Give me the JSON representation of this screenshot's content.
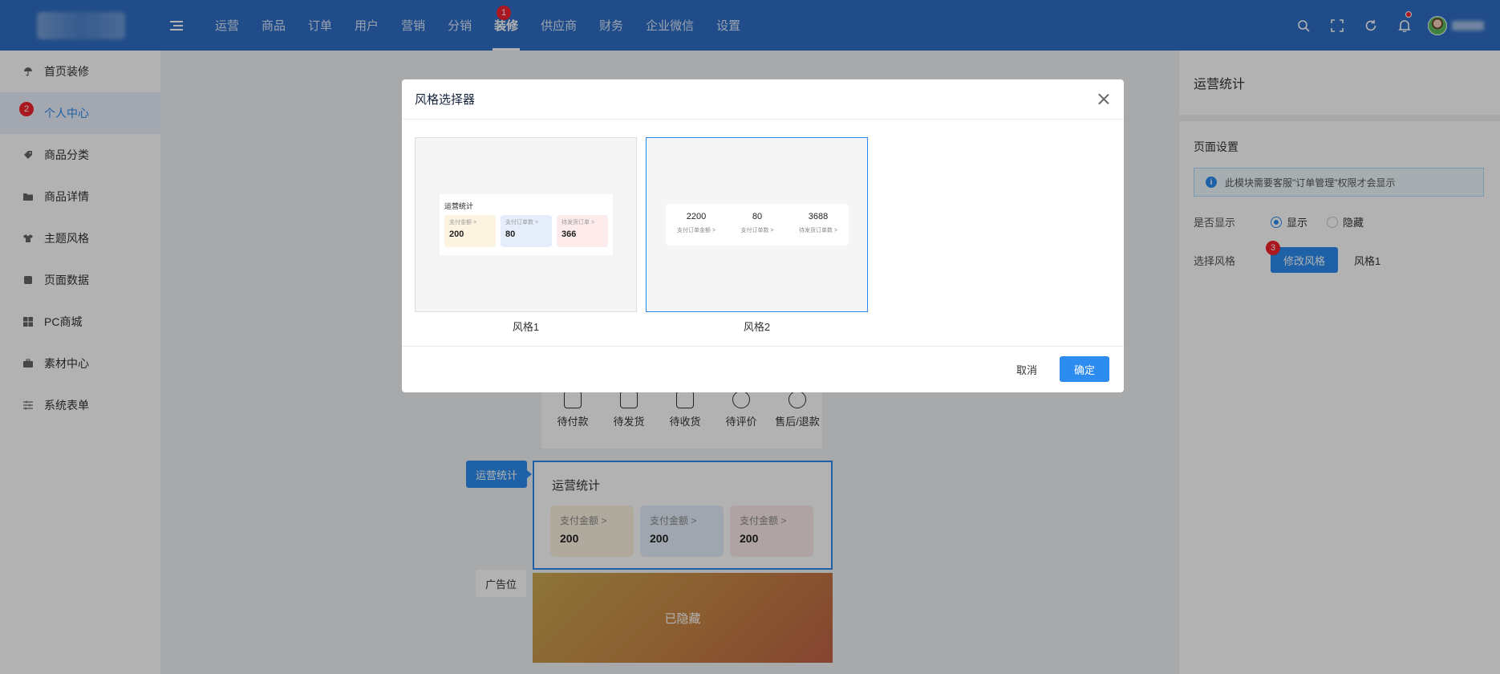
{
  "nav": {
    "items": [
      "运营",
      "商品",
      "订单",
      "用户",
      "营销",
      "分销",
      "装修",
      "供应商",
      "财务",
      "企业微信",
      "设置"
    ],
    "active_index": 6,
    "active_badge": "1"
  },
  "sidebar": {
    "items": [
      {
        "label": "首页装修",
        "icon": "umbrella-icon"
      },
      {
        "label": "个人中心",
        "icon": "user-icon"
      },
      {
        "label": "商品分类",
        "icon": "tag-icon"
      },
      {
        "label": "商品详情",
        "icon": "folder-icon"
      },
      {
        "label": "主题风格",
        "icon": "shirt-icon"
      },
      {
        "label": "页面数据",
        "icon": "database-icon"
      },
      {
        "label": "PC商城",
        "icon": "windows-icon"
      },
      {
        "label": "素材中心",
        "icon": "briefcase-icon"
      },
      {
        "label": "系统表单",
        "icon": "sliders-icon"
      }
    ],
    "active_index": 1,
    "active_badge": "2"
  },
  "canvas": {
    "order_items": [
      "待付款",
      "待发货",
      "待收货",
      "待评价",
      "售后/退款"
    ],
    "stats_tag": "运营统计",
    "stats_title": "运营统计",
    "stats_cards": [
      {
        "label": "支付金额 >",
        "value": "200",
        "color": "#fdf3e1"
      },
      {
        "label": "支付金额 >",
        "value": "200",
        "color": "#e6eefb"
      },
      {
        "label": "支付金额 >",
        "value": "200",
        "color": "#fdeaea"
      }
    ],
    "ad_tag": "广告位",
    "banner_text": "已隐藏"
  },
  "right_panel": {
    "title": "运营统计",
    "section_title": "页面设置",
    "notice": "此模块需要客服\"订单管理\"权限才会显示",
    "show_label": "是否显示",
    "show_option": "显示",
    "hide_option": "隐藏",
    "style_label": "选择风格",
    "style_button": "修改风格",
    "style_badge": "3",
    "style_value": "风格1"
  },
  "dialog": {
    "title": "风格选择器",
    "options": [
      {
        "name": "风格1",
        "preview_title": "运营统计",
        "cards": [
          {
            "label": "支付金额 >",
            "value": "200",
            "color": "#fdf3e1"
          },
          {
            "label": "支付订单数 >",
            "value": "80",
            "color": "#e6eefb"
          },
          {
            "label": "待发货订单 >",
            "value": "366",
            "color": "#fdeaea"
          }
        ]
      },
      {
        "name": "风格2",
        "items": [
          {
            "value": "2200",
            "label": "支付订单金额 >"
          },
          {
            "value": "80",
            "label": "支付订单数 >"
          },
          {
            "value": "3688",
            "label": "待发货订单数 >"
          }
        ]
      }
    ],
    "selected_index": 1,
    "cancel_label": "取消",
    "ok_label": "确定"
  },
  "colors": {
    "primary": "#2d8cf0",
    "topbar": "#2f6ec4",
    "badge": "#f5222d"
  }
}
